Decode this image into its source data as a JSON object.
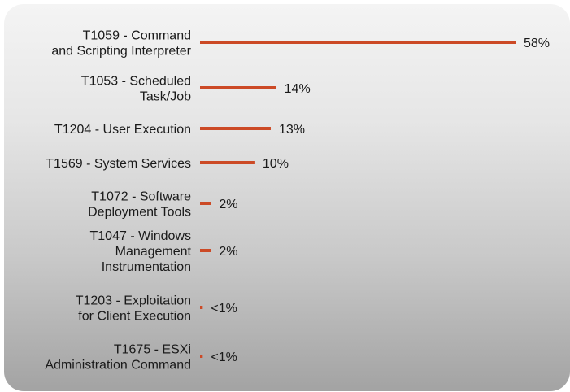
{
  "chart_data": {
    "type": "bar",
    "orientation": "horizontal",
    "categories": [
      [
        "T1059 - Command",
        "and Scripting Interpreter"
      ],
      [
        "T1053 - Scheduled",
        "Task/Job"
      ],
      [
        "T1204 - User Execution"
      ],
      [
        "T1569 - System Services"
      ],
      [
        "T1072 - Software",
        "Deployment Tools"
      ],
      [
        "T1047 - Windows",
        "Management",
        "Instrumentation"
      ],
      [
        "T1203 - Exploitation",
        "for Client Execution"
      ],
      [
        "T1675 - ESXi",
        "Administration Command"
      ]
    ],
    "values": [
      58,
      14,
      13,
      10,
      2,
      2,
      0.5,
      0.5
    ],
    "value_labels": [
      "58%",
      "14%",
      "13%",
      "10%",
      "2%",
      "2%",
      "<1%",
      "<1%"
    ],
    "xlim": [
      0,
      58
    ],
    "grid": false,
    "bar_color": "#cc4a26"
  }
}
